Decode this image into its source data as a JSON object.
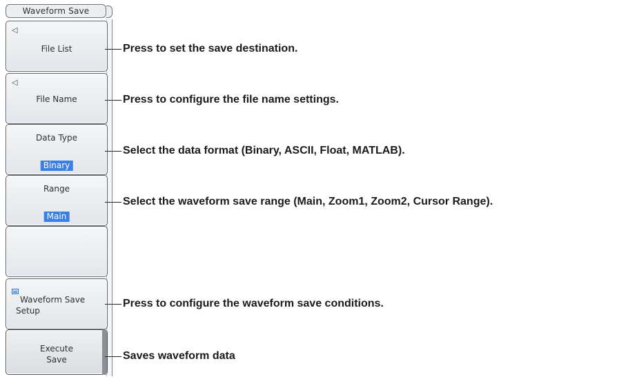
{
  "menu": {
    "title": "Waveform Save",
    "keys": [
      {
        "label": "File List",
        "icon": "back-arrow-icon",
        "glyph": "◁"
      },
      {
        "label": "File Name",
        "icon": "back-arrow-icon",
        "glyph": "◁"
      },
      {
        "label": "Data Type",
        "value": "Binary"
      },
      {
        "label": "Range",
        "value": "Main"
      },
      {
        "label": ""
      },
      {
        "label_line1": "Waveform Save",
        "label_line2": "Setup",
        "icon": "setup-icon"
      },
      {
        "label_line1": "Execute",
        "label_line2": "Save"
      }
    ]
  },
  "callouts": [
    "Press to set the save destination.",
    "Press to configure the file name settings.",
    "Select the data format (Binary, ASCII, Float, MATLAB).",
    "Select the waveform save range (Main, Zoom1, Zoom2, Cursor Range).",
    "Press to configure the waveform save conditions.",
    "Saves waveform data"
  ],
  "colors": {
    "selected_value_bg": "#3b7fe3",
    "key_border": "#5c6166",
    "text": "#1a1a1a"
  }
}
